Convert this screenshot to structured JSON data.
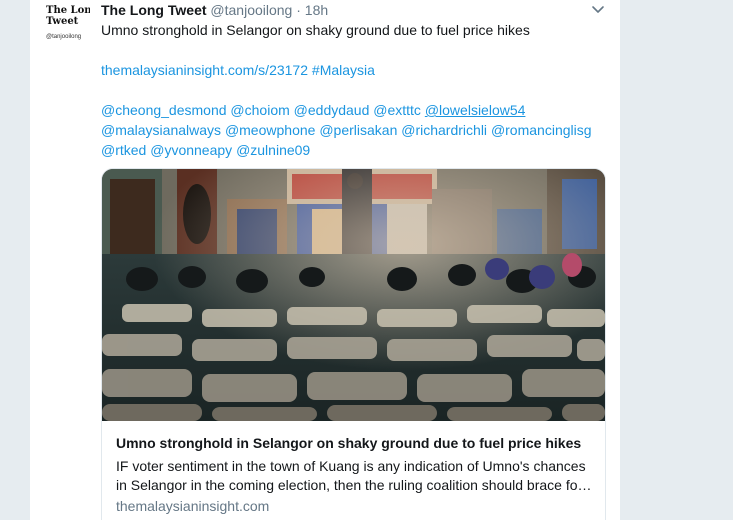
{
  "tweet": {
    "avatar": {
      "line1": "The Long",
      "line2": "Tweet",
      "handle": "@tanjooilong"
    },
    "author_name": "The Long Tweet",
    "author_handle": "@tanjooilong",
    "separator": "·",
    "time": "18h",
    "text": "Umno stronghold in Selangor on shaky ground due to fuel price hikes",
    "url": "themalaysianinsight.com/s/23172",
    "hashtag": "#Malaysia",
    "mentions_line1": [
      "@cheong_desmond",
      "@choiom",
      "@eddydaud",
      "@extttc",
      "@lowelsielow54"
    ],
    "mentions_line2": [
      "@malaysianalways",
      "@meowphone",
      "@perlisakan",
      "@richardrichli",
      "@romancinglisg"
    ],
    "mentions_line3": [
      "@rtked",
      "@yvonneapy",
      "@zulnine09"
    ],
    "caret_icon": "chevron-down-icon"
  },
  "card": {
    "image_icon": "event-hall-photo",
    "title": "Umno stronghold in Selangor on shaky ground due to fuel price hikes",
    "description_line1": "IF voter sentiment in the town of Kuang is any indication of Umno's chances",
    "description_line2": "in Selangor in the coming election, then the ruling coalition should brace for a tough fight",
    "domain": "themalaysianinsight.com"
  },
  "colors": {
    "link": "#1b95e0",
    "secondary_text": "#657786",
    "page_background": "#e6ecf0"
  }
}
